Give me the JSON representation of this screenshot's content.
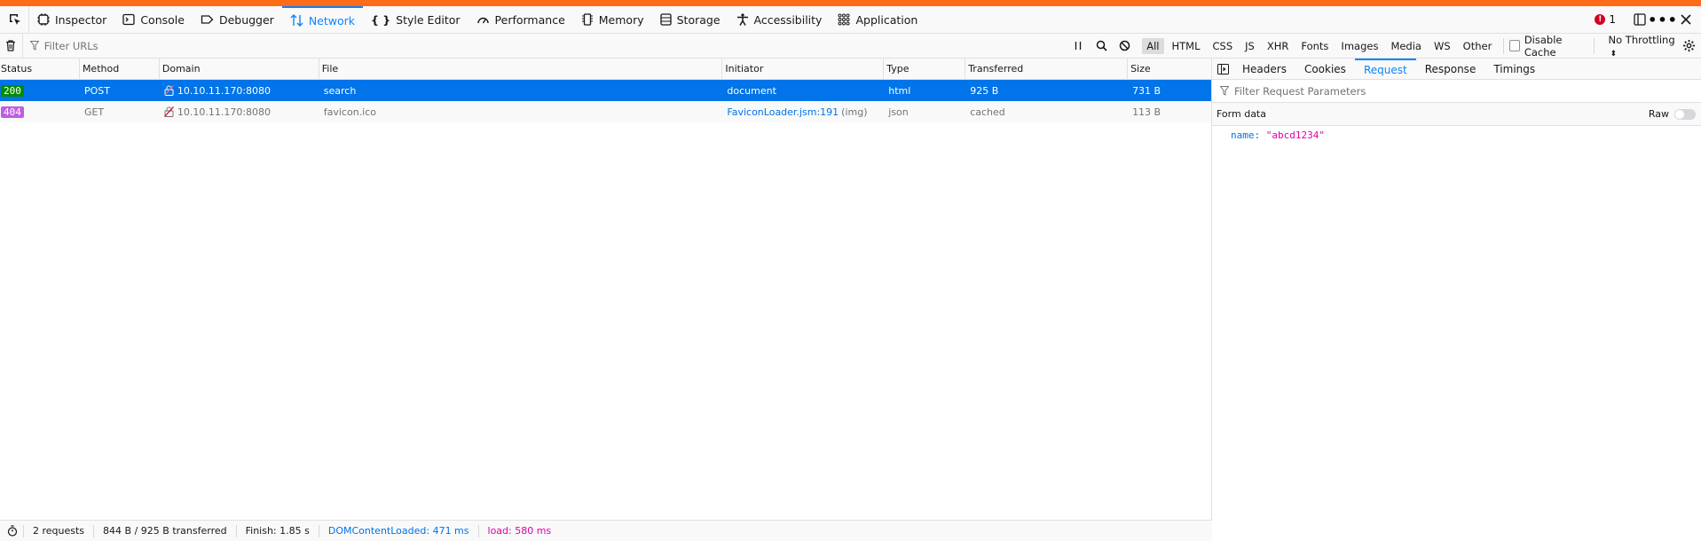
{
  "toolbar": {
    "tabs": [
      {
        "label": "Inspector",
        "icon": "inspector-icon"
      },
      {
        "label": "Console",
        "icon": "console-icon"
      },
      {
        "label": "Debugger",
        "icon": "debugger-icon"
      },
      {
        "label": "Network",
        "icon": "network-icon",
        "selected": true
      },
      {
        "label": "Style Editor",
        "icon": "braces-icon"
      },
      {
        "label": "Performance",
        "icon": "gauge-icon"
      },
      {
        "label": "Memory",
        "icon": "chip-icon"
      },
      {
        "label": "Storage",
        "icon": "storage-icon"
      },
      {
        "label": "Accessibility",
        "icon": "accessibility-icon"
      },
      {
        "label": "Application",
        "icon": "grid-icon"
      }
    ],
    "error_count": "1",
    "accent": "#0a84ff",
    "topbar_color": "#ff6c18"
  },
  "filter": {
    "placeholder": "Filter URLs",
    "types": [
      "All",
      "HTML",
      "CSS",
      "JS",
      "XHR",
      "Fonts",
      "Images",
      "Media",
      "WS",
      "Other"
    ],
    "selected_type": "All",
    "disable_cache_label": "Disable Cache",
    "throttling": "No Throttling"
  },
  "table": {
    "columns": [
      "Status",
      "Method",
      "Domain",
      "File",
      "Initiator",
      "Type",
      "Transferred",
      "Size"
    ],
    "rows": [
      {
        "status": "200",
        "method": "POST",
        "domain": "10.10.11.170:8080",
        "file": "search",
        "initiator": "document",
        "initiator_extra": "",
        "type": "html",
        "transferred": "925 B",
        "size": "731 B",
        "status_color": "#058b00"
      },
      {
        "status": "404",
        "method": "GET",
        "domain": "10.10.11.170:8080",
        "file": "favicon.ico",
        "initiator": "FaviconLoader.jsm:191",
        "initiator_extra": "(img)",
        "type": "json",
        "transferred": "cached",
        "size": "113 B",
        "status_color": "#bf5ee0"
      }
    ]
  },
  "footer": {
    "requests": "2 requests",
    "transferred": "844 B / 925 B transferred",
    "finish": "Finish: 1.85 s",
    "dom": "DOMContentLoaded: 471 ms",
    "load": "load: 580 ms"
  },
  "side": {
    "tabs": [
      "Headers",
      "Cookies",
      "Request",
      "Response",
      "Timings"
    ],
    "selected_tab": "Request",
    "filter_placeholder": "Filter Request Parameters",
    "form_data_label": "Form data",
    "raw_label": "Raw",
    "params": [
      {
        "key": "name:",
        "value": "\"abcd1234\""
      }
    ]
  }
}
